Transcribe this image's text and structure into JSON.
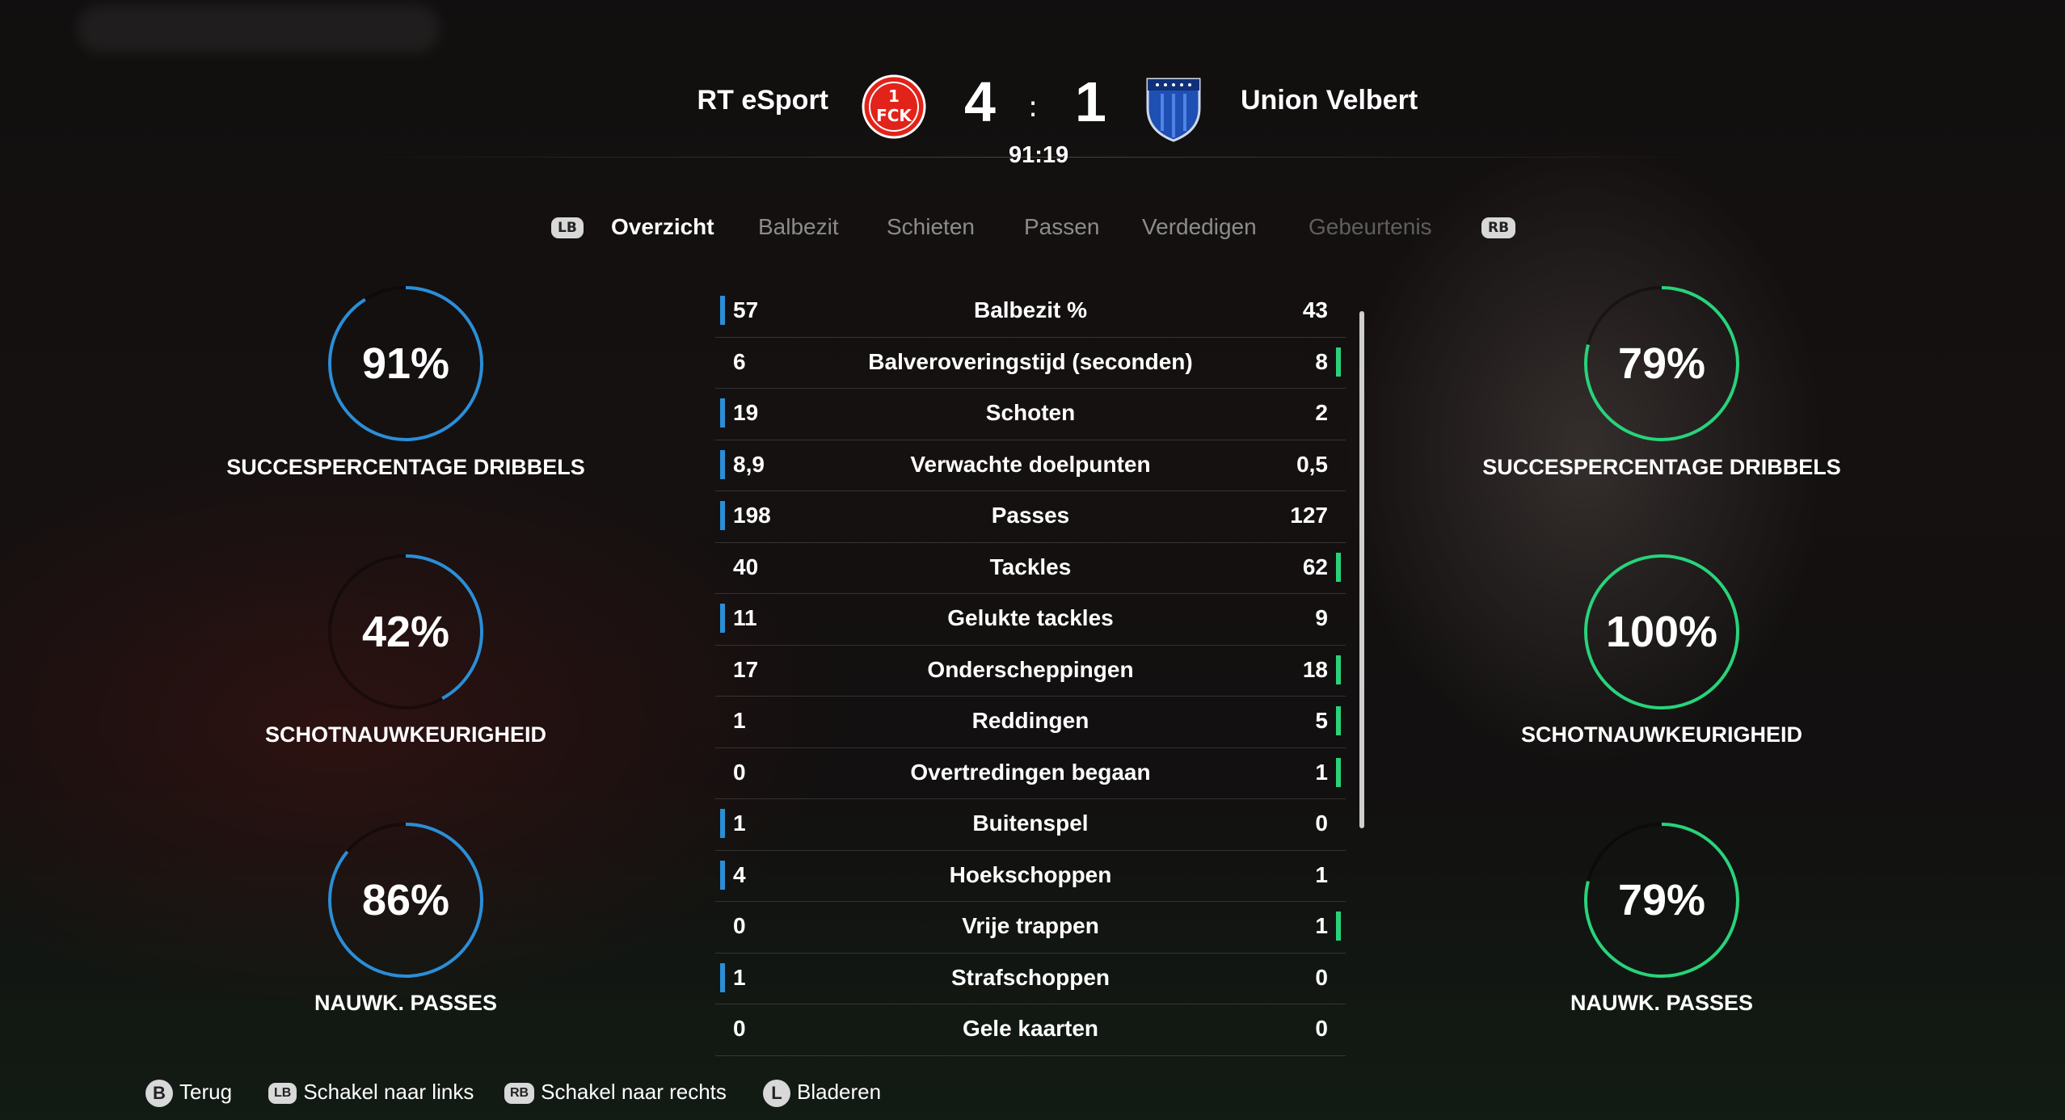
{
  "header": {
    "home_team": "RT eSport",
    "away_team": "Union Velbert",
    "home_score": "4",
    "separator": ":",
    "away_score": "1",
    "match_time": "91:19"
  },
  "tabs": {
    "left_button": "LB",
    "right_button": "RB",
    "items": [
      "Overzicht",
      "Balbezit",
      "Schieten",
      "Passen",
      "Verdedigen",
      "Gebeurtenis"
    ],
    "active_index": 0
  },
  "home_gauges": [
    {
      "value": "91%",
      "fraction": 0.91,
      "label": "SUCCESPERCENTAGE DRIBBELS"
    },
    {
      "value": "42%",
      "fraction": 0.42,
      "label": "SCHOTNAUWKEURIGHEID"
    },
    {
      "value": "86%",
      "fraction": 0.86,
      "label": "NAUWK. PASSES"
    }
  ],
  "away_gauges": [
    {
      "value": "79%",
      "fraction": 0.79,
      "label": "SUCCESPERCENTAGE DRIBBELS"
    },
    {
      "value": "100%",
      "fraction": 1.0,
      "label": "SCHOTNAUWKEURIGHEID"
    },
    {
      "value": "79%",
      "fraction": 0.79,
      "label": "NAUWK. PASSES"
    }
  ],
  "stats": [
    {
      "name": "Balbezit %",
      "home": "57",
      "away": "43",
      "leader": "home"
    },
    {
      "name": "Balveroveringstijd (seconden)",
      "home": "6",
      "away": "8",
      "leader": "away"
    },
    {
      "name": "Schoten",
      "home": "19",
      "away": "2",
      "leader": "home"
    },
    {
      "name": "Verwachte doelpunten",
      "home": "8,9",
      "away": "0,5",
      "leader": "home"
    },
    {
      "name": "Passes",
      "home": "198",
      "away": "127",
      "leader": "home"
    },
    {
      "name": "Tackles",
      "home": "40",
      "away": "62",
      "leader": "away"
    },
    {
      "name": "Gelukte tackles",
      "home": "11",
      "away": "9",
      "leader": "home"
    },
    {
      "name": "Onderscheppingen",
      "home": "17",
      "away": "18",
      "leader": "away"
    },
    {
      "name": "Reddingen",
      "home": "1",
      "away": "5",
      "leader": "away"
    },
    {
      "name": "Overtredingen begaan",
      "home": "0",
      "away": "1",
      "leader": "away"
    },
    {
      "name": "Buitenspel",
      "home": "1",
      "away": "0",
      "leader": "home"
    },
    {
      "name": "Hoekschoppen",
      "home": "4",
      "away": "1",
      "leader": "home"
    },
    {
      "name": "Vrije trappen",
      "home": "0",
      "away": "1",
      "leader": "away"
    },
    {
      "name": "Strafschoppen",
      "home": "1",
      "away": "0",
      "leader": "home"
    },
    {
      "name": "Gele kaarten",
      "home": "0",
      "away": "0",
      "leader": "none"
    }
  ],
  "footer": {
    "back_button": "B",
    "back_label": "Terug",
    "lb_button": "LB",
    "lb_label": "Schakel naar links",
    "rb_button": "RB",
    "rb_label": "Schakel naar rechts",
    "scroll_button": "L",
    "scroll_label": "Bladeren"
  },
  "colors": {
    "home_accent": "#2b8ed8",
    "away_accent": "#28d37a",
    "home_crest": "#e2231a",
    "away_crest": "#1e4fb3"
  }
}
